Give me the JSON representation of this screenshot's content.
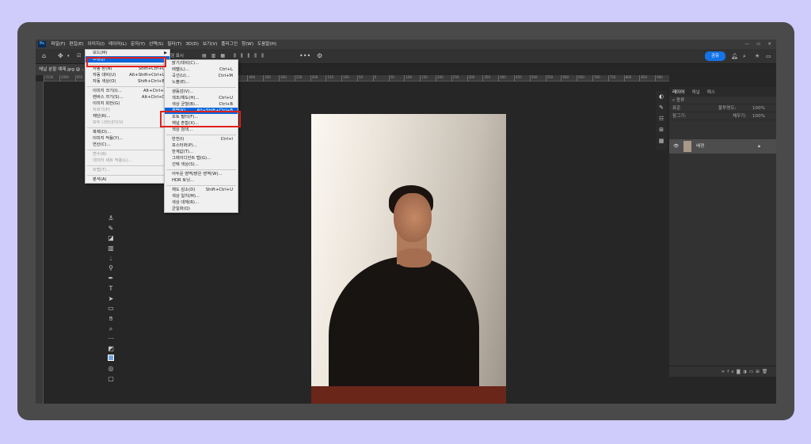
{
  "app": {
    "logo": "Ps",
    "colors": {
      "accent": "#1473e6",
      "highlight": "#0c66d9",
      "annotation": "#e0211b",
      "background": "#cfcbfb"
    }
  },
  "menubar": {
    "items": [
      "파일(F)",
      "편집(E)",
      "이미지(I)",
      "레이어(L)",
      "문자(Y)",
      "선택(S)",
      "필터(T)",
      "3D(D)",
      "보기(V)",
      "플러그인",
      "창(W)",
      "도움말(H)"
    ],
    "window_controls": [
      "—",
      "▭",
      "✕"
    ]
  },
  "optionsbar": {
    "share_label": "공유",
    "visible_text": "도형 표시"
  },
  "document": {
    "tab_title": "채널 분할 예제.jpg @ ..."
  },
  "ruler": {
    "ticks": [
      "1100",
      "1000",
      "950",
      "900",
      "850",
      "800",
      "750",
      "700",
      "650",
      "600",
      "550",
      "500",
      "450",
      "400",
      "350",
      "300",
      "250",
      "200",
      "150",
      "100",
      "50",
      "0",
      "50",
      "100",
      "150",
      "200",
      "250",
      "300",
      "350",
      "400",
      "450",
      "500",
      "550",
      "600",
      "650",
      "700",
      "750",
      "800",
      "850",
      "900"
    ]
  },
  "image_menu": [
    {
      "label": "모드(M)",
      "arrow": "▶"
    },
    {
      "label": "조정(J)",
      "arrow": "▶",
      "highlighted": true
    },
    {
      "sep": true
    },
    {
      "label": "자동 톤(N)",
      "shortcut": "Shift+Ctrl+L"
    },
    {
      "label": "자동 대비(U)",
      "shortcut": "Alt+Shift+Ctrl+L"
    },
    {
      "label": "자동 색상(O)",
      "shortcut": "Shift+Ctrl+B"
    },
    {
      "sep": true
    },
    {
      "label": "이미지 크기(I)...",
      "shortcut": "Alt+Ctrl+I"
    },
    {
      "label": "캔버스 크기(S)...",
      "shortcut": "Alt+Ctrl+C"
    },
    {
      "label": "이미지 회전(G)",
      "arrow": "▶"
    },
    {
      "label": "자르기(P)",
      "disabled": true
    },
    {
      "label": "재단(R)..."
    },
    {
      "label": "모두 나타내기(V)",
      "disabled": true
    },
    {
      "sep": true
    },
    {
      "label": "복제(D)..."
    },
    {
      "label": "이미지 적용(Y)..."
    },
    {
      "label": "연산(C)..."
    },
    {
      "sep": true
    },
    {
      "label": "변수(B)",
      "arrow": "▶",
      "disabled": true
    },
    {
      "label": "데이터 세트 적용(L)...",
      "disabled": true
    },
    {
      "sep": true
    },
    {
      "label": "트랩(T)...",
      "disabled": true
    },
    {
      "sep": true
    },
    {
      "label": "분석(A)",
      "arrow": "▶"
    }
  ],
  "adjust_menu": [
    {
      "label": "밝기/대비(C)..."
    },
    {
      "label": "레벨(L)...",
      "shortcut": "Ctrl+L"
    },
    {
      "label": "곡선(U)...",
      "shortcut": "Ctrl+M"
    },
    {
      "label": "노출(E)..."
    },
    {
      "sep": true
    },
    {
      "label": "생동감(V)..."
    },
    {
      "label": "색조/채도(H)...",
      "shortcut": "Ctrl+U"
    },
    {
      "label": "색상 균형(B)...",
      "shortcut": "Ctrl+B"
    },
    {
      "label": "흑백(K)...",
      "shortcut": "Alt+Shift+Ctrl+B",
      "highlighted": true
    },
    {
      "label": "포토 필터(F)..."
    },
    {
      "label": "채널 혼합(X)..."
    },
    {
      "label": "색상 검색..."
    },
    {
      "sep": true
    },
    {
      "label": "반전(I)",
      "shortcut": "Ctrl+I"
    },
    {
      "label": "포스터화(P)..."
    },
    {
      "label": "한계값(T)..."
    },
    {
      "label": "그레이디언트 맵(G)..."
    },
    {
      "label": "선택 색상(S)..."
    },
    {
      "sep": true
    },
    {
      "label": "어두운 영역/밝은 영역(W)..."
    },
    {
      "label": "HDR 토닝..."
    },
    {
      "sep": true
    },
    {
      "label": "채도 감소(D)",
      "shortcut": "Shift+Ctrl+U"
    },
    {
      "label": "색상 일치(M)..."
    },
    {
      "label": "색상 대체(R)..."
    },
    {
      "label": "균일화(Q)"
    }
  ],
  "layers_panel": {
    "tabs": [
      "레이어",
      "채널",
      "패스"
    ],
    "search_placeholder": "종류",
    "blend_mode": "표준",
    "opacity_label": "불투명도:",
    "opacity_value": "100%",
    "lock_label": "잠그기:",
    "fill_label": "채우기:",
    "fill_value": "100%",
    "layer_name": "배경",
    "footer_icons": [
      "link-icon",
      "fx-icon",
      "mask-icon",
      "adjustment-icon",
      "group-icon",
      "new-layer-icon",
      "trash-icon"
    ]
  }
}
